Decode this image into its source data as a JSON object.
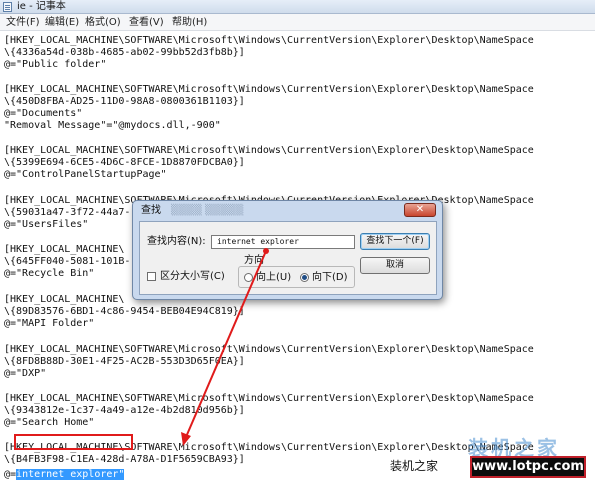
{
  "window": {
    "title": "ie - 记事本"
  },
  "menu": {
    "items": [
      "文件(F)",
      "编辑(E)",
      "格式(O)",
      "查看(V)",
      "帮助(H)"
    ]
  },
  "editor": {
    "lines": [
      "[HKEY_LOCAL_MACHINE\\SOFTWARE\\Microsoft\\Windows\\CurrentVersion\\Explorer\\Desktop\\NameSpace",
      "\\{4336a54d-038b-4685-ab02-99bb52d3fb8b}]",
      "@=\"Public folder\"",
      "",
      "[HKEY_LOCAL_MACHINE\\SOFTWARE\\Microsoft\\Windows\\CurrentVersion\\Explorer\\Desktop\\NameSpace",
      "\\{450D8FBA-AD25-11D0-98A8-0800361B1103}]",
      "@=\"Documents\"",
      "\"Removal Message\"=\"@mydocs.dll,-900\"",
      "",
      "[HKEY_LOCAL_MACHINE\\SOFTWARE\\Microsoft\\Windows\\CurrentVersion\\Explorer\\Desktop\\NameSpace",
      "\\{5399E694-6CE5-4D6C-8FCE-1D8870FDCBA0}]",
      "@=\"ControlPanelStartupPage\"",
      "",
      "[HKEY_LOCAL_MACHINE\\SOFTWARE\\Microsoft\\Windows\\CurrentVersion\\Explorer\\Desktop\\NameSpace",
      "\\{59031a47-3f72-44a7-",
      "@=\"UsersFiles\"",
      "",
      "[HKEY_LOCAL_MACHINE\\",
      "\\{645FF040-5081-101B-",
      "@=\"Recycle Bin\"",
      "",
      "[HKEY_LOCAL_MACHINE\\",
      "\\{89D83576-6BD1-4c86-9454-BEB04E94C819}]",
      "@=\"MAPI Folder\"",
      "",
      "[HKEY_LOCAL_MACHINE\\SOFTWARE\\Microsoft\\Windows\\CurrentVersion\\Explorer\\Desktop\\NameSpace",
      "\\{8FD8B88D-30E1-4F25-AC2B-553D3D65F0EA}]",
      "@=\"DXP\"",
      "",
      "[HKEY_LOCAL_MACHINE\\SOFTWARE\\Microsoft\\Windows\\CurrentVersion\\Explorer\\Desktop\\NameSpace",
      "\\{9343812e-1c37-4a49-a12e-4b2d810d956b}]",
      "@=\"Search Home\"",
      "",
      "[HKEY_LOCAL_MACHINE\\SOFTWARE\\Microsoft\\Windows\\CurrentVersion\\Explorer\\Desktop\\NameSpace",
      "\\{B4FB3F98-C1EA-428d-A78A-D1F5659CBA93}]"
    ],
    "last_line_prefix": "@=",
    "selected_text": "internet explorer\""
  },
  "find_dialog": {
    "title": "查找",
    "close_label": "✕",
    "find_what_label": "查找内容(N):",
    "find_what_value": "internet explorer",
    "find_next_label": "查找下一个(F)",
    "cancel_label": "取消",
    "direction_label": "方向",
    "up_label": "向上(U)",
    "down_label": "向下(D)",
    "match_case_label": "区分大小写(C)",
    "direction_selected": "down",
    "match_case_checked": false
  },
  "watermark": {
    "big": "装机之家",
    "small": "装机之家",
    "url": "www.lotpc.com"
  },
  "colors": {
    "selection": "#3399ff",
    "annotation_red": "#e01b1b",
    "dialog_frame": "#c9d9ee"
  }
}
